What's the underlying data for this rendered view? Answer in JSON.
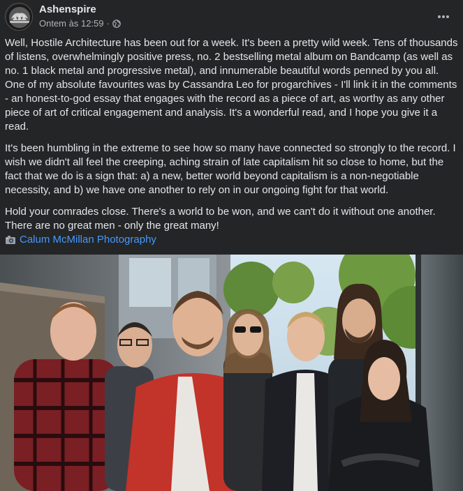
{
  "post": {
    "author": "Ashenspire",
    "timestamp": "Ontem às 12:59",
    "separator": "·",
    "audience_icon": "globe-icon",
    "more_icon": "more-horizontal-icon",
    "paragraphs": [
      "Well, Hostile Architecture has been out for a week. It's been a pretty wild week. Tens of thousands of listens, overwhelmingly positive press, no. 2 bestselling metal album on Bandcamp (as well as no. 1 black metal and progressive metal), and innumerable beautiful words penned by you all. One of my absolute favourites was by Cassandra Leo for progarchives - I'll link it in the comments - an honest-to-god essay that engages with the record as a piece of art, as worthy as any other piece of art of critical engagement and analysis. It's a wonderful read, and I hope you give it a read.",
      "It's been humbling in the extreme to see how so many have connected so strongly to the record. I wish we didn't all feel the creeping, aching strain of late capitalism hit so close to home, but the fact that we do is a sign that: a) a new, better world beyond capitalism is a non-negotiable necessity, and b) we have one another to rely on in our ongoing fight for that world.",
      "Hold your comrades close. There's a world to be won, and we can't do it without one another. There are no great men - only the great many!"
    ],
    "credit_icon": "camera-icon",
    "credit_link": "Calum McMillan Photography"
  },
  "colors": {
    "background": "#242526",
    "text": "#e4e6eb",
    "secondary_text": "#b0b3b8",
    "link": "#4599ff"
  }
}
